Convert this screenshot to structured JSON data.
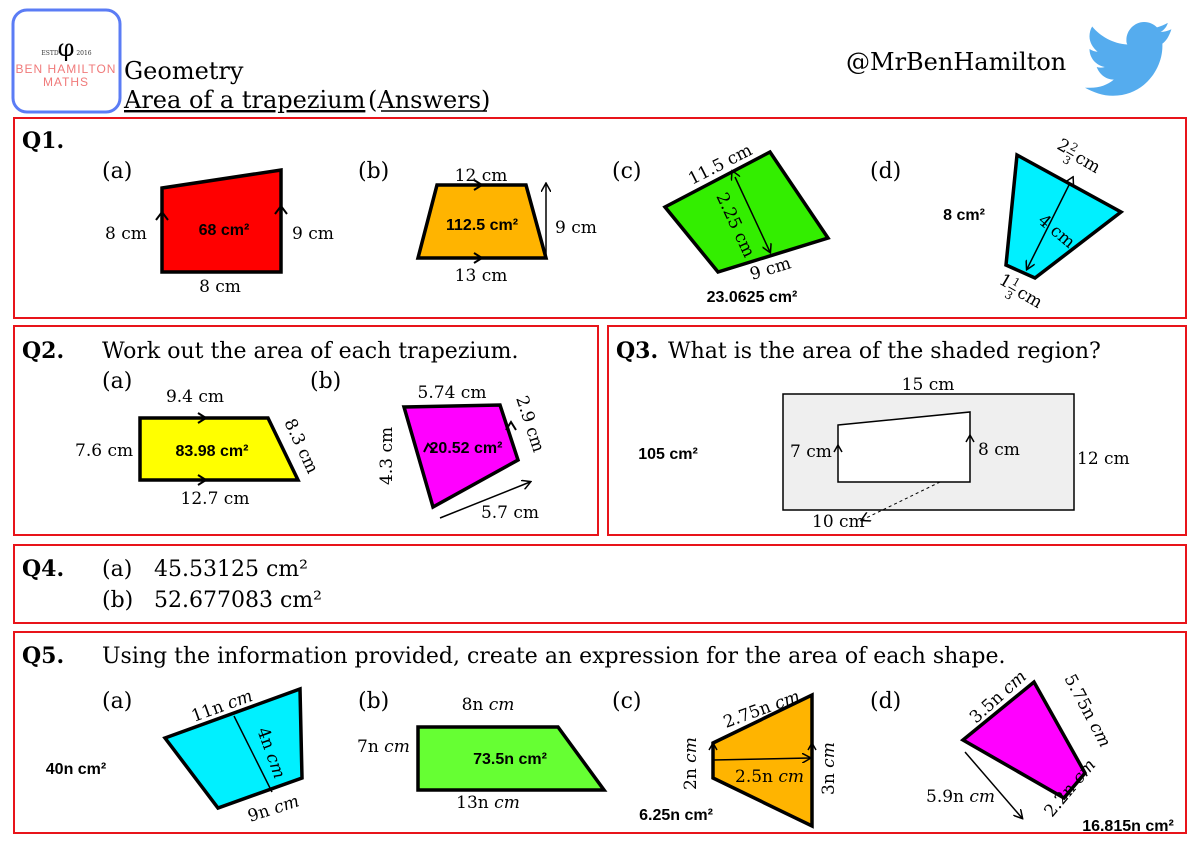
{
  "header": {
    "logo": {
      "estd": "ESTD",
      "year": "2016",
      "line1": "BEN HAMILTON",
      "line2": "MATHS",
      "border_color": "#5b7cf5",
      "text_color": "#f07a7a"
    },
    "topic": "Geometry",
    "subtitle": "Area of a trapezium",
    "answers_label": "(Answers)",
    "twitter_handle": "@MrBenHamilton",
    "twitter_icon": "twitter-bird-icon",
    "twitter_color": "#55acee"
  },
  "colors": {
    "box_border": "#e8141a",
    "red": "#ff0000",
    "orange": "#ffb400",
    "green": "#33ee00",
    "cyan": "#00f0ff",
    "yellow": "#ffff00",
    "magenta": "#ff00ff",
    "lime": "#66ff33"
  },
  "q1": {
    "label": "Q1.",
    "a": {
      "part": "(a)",
      "left": "8 cm",
      "right": "9 cm",
      "bottom": "8 cm",
      "answer": "68 cm²"
    },
    "b": {
      "part": "(b)",
      "top": "12 cm",
      "bottom": "13 cm",
      "height": "9 cm",
      "answer": "112.5 cm²"
    },
    "c": {
      "part": "(c)",
      "top": "11.5 cm",
      "height": "2.25 cm",
      "bottom": "9 cm",
      "answer": "23.0625 cm²"
    },
    "d": {
      "part": "(d)",
      "top_whole": "2",
      "top_num": "2",
      "top_den": "3",
      "top_unit": "cm",
      "height": "4 cm",
      "bottom_whole": "1",
      "bottom_num": "1",
      "bottom_den": "3",
      "bottom_unit": "cm",
      "answer": "8 cm²"
    }
  },
  "q2": {
    "label": "Q2.",
    "prompt": "Work out the area of each trapezium.",
    "a": {
      "part": "(a)",
      "top": "9.4 cm",
      "left": "7.6 cm",
      "slant": "8.3 cm",
      "bottom": "12.7 cm",
      "answer": "83.98 cm²"
    },
    "b": {
      "part": "(b)",
      "top": "5.74 cm",
      "left": "4.3 cm",
      "right": "2.9 cm",
      "bottom": "5.7 cm",
      "answer": "20.52 cm²"
    }
  },
  "q3": {
    "label": "Q3.",
    "prompt": "What is the area of the shaded region?",
    "outer_width": "15 cm",
    "outer_height": "12 cm",
    "inner_left": "7 cm",
    "inner_right": "8 cm",
    "inner_width": "10 cm",
    "answer": "105 cm²"
  },
  "q4": {
    "label": "Q4.",
    "a": {
      "part": "(a)",
      "answer": "45.53125 cm²"
    },
    "b": {
      "part": "(b)",
      "answer": "52.677083̇ cm²"
    }
  },
  "q5": {
    "label": "Q5.",
    "prompt": "Using the information provided, create an expression for the area of each shape.",
    "a": {
      "part": "(a)",
      "top": "11n",
      "height": "4n",
      "bottom": "9n",
      "unit": "cm",
      "answer": "40n cm²"
    },
    "b": {
      "part": "(b)",
      "top": "8n",
      "left": "7n",
      "bottom": "13n",
      "unit": "cm",
      "answer": "73.5n cm²"
    },
    "c": {
      "part": "(c)",
      "top": "2.75n",
      "left": "2n",
      "mid": "2.5n",
      "right": "3n",
      "unit": "cm",
      "answer": "6.25n cm²"
    },
    "d": {
      "part": "(d)",
      "top": "3.5n",
      "right": "5.75n",
      "left": "5.9n",
      "bottom": "2.2n",
      "unit": "cm",
      "answer": "16.815n cm²"
    }
  }
}
